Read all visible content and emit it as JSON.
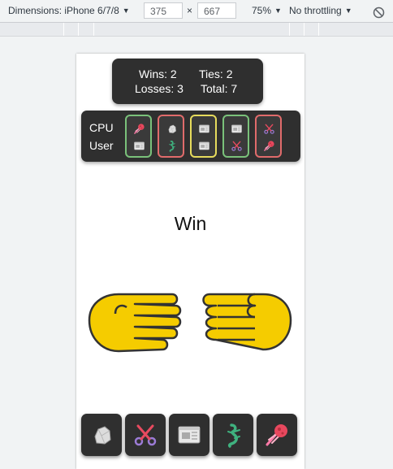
{
  "devtools": {
    "dimensions_label": "Dimensions: iPhone 6/7/8",
    "width_value": "375",
    "times_symbol": "×",
    "height_value": "667",
    "zoom_label": "75%",
    "throttle_label": "No throttling",
    "rotate_icon": "rotate-icon"
  },
  "score": {
    "wins": "Wins: 2",
    "ties": "Ties: 2",
    "losses": "Losses: 3",
    "total": "Total: 7"
  },
  "history": {
    "cpu_label": "CPU",
    "user_label": "User",
    "rounds": [
      {
        "cpu": "spock",
        "user": "paper",
        "outcome": "win",
        "border": "#7ac17a"
      },
      {
        "cpu": "rock",
        "user": "lizard",
        "outcome": "loss",
        "border": "#e06b6b"
      },
      {
        "cpu": "paper",
        "user": "paper",
        "outcome": "tie",
        "border": "#e6db5c"
      },
      {
        "cpu": "paper",
        "user": "scissors",
        "outcome": "win",
        "border": "#7ac17a"
      },
      {
        "cpu": "scissors",
        "user": "spock",
        "outcome": "loss",
        "border": "#e06b6b"
      }
    ]
  },
  "result_text": "Win",
  "hands": {
    "left": "cpu-paper-hand",
    "right": "user-rock-hand",
    "color": "#f5cc00"
  },
  "choices": [
    "rock",
    "scissors",
    "paper",
    "lizard",
    "spock"
  ]
}
